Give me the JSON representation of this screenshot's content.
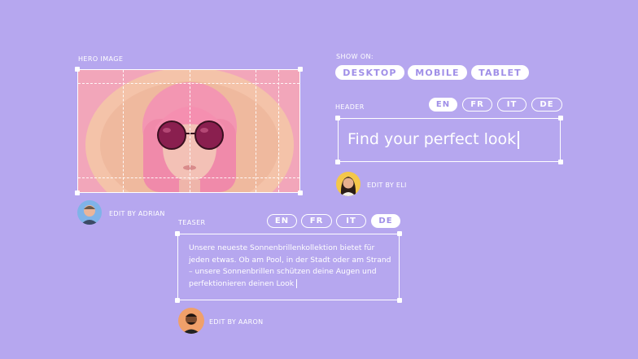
{
  "hero": {
    "label": "HERO IMAGE",
    "editor_label": "EDIT BY ADRIAN"
  },
  "show_on": {
    "label": "SHOW ON:",
    "options": [
      "DESKTOP",
      "MOBILE",
      "TABLET"
    ]
  },
  "header": {
    "label": "HEADER",
    "languages": [
      "EN",
      "FR",
      "IT",
      "DE"
    ],
    "active_language": "EN",
    "text": "Find your perfect look",
    "editor_label": "EDIT BY ELI"
  },
  "teaser": {
    "label": "TEASER",
    "languages": [
      "EN",
      "FR",
      "IT",
      "DE"
    ],
    "active_language": "DE",
    "text": "Unsere neueste Sonnenbrillenkollektion bietet für jeden etwas. Ob am Pool, in der Stadt oder am Strand – unsere Sonnenbrillen schützen deine Augen und perfektionieren deinen Look",
    "editor_label": "EDIT BY AARON"
  },
  "colors": {
    "background": "#b6a7ef",
    "accent_text": "#a08fe8",
    "white": "#ffffff"
  }
}
